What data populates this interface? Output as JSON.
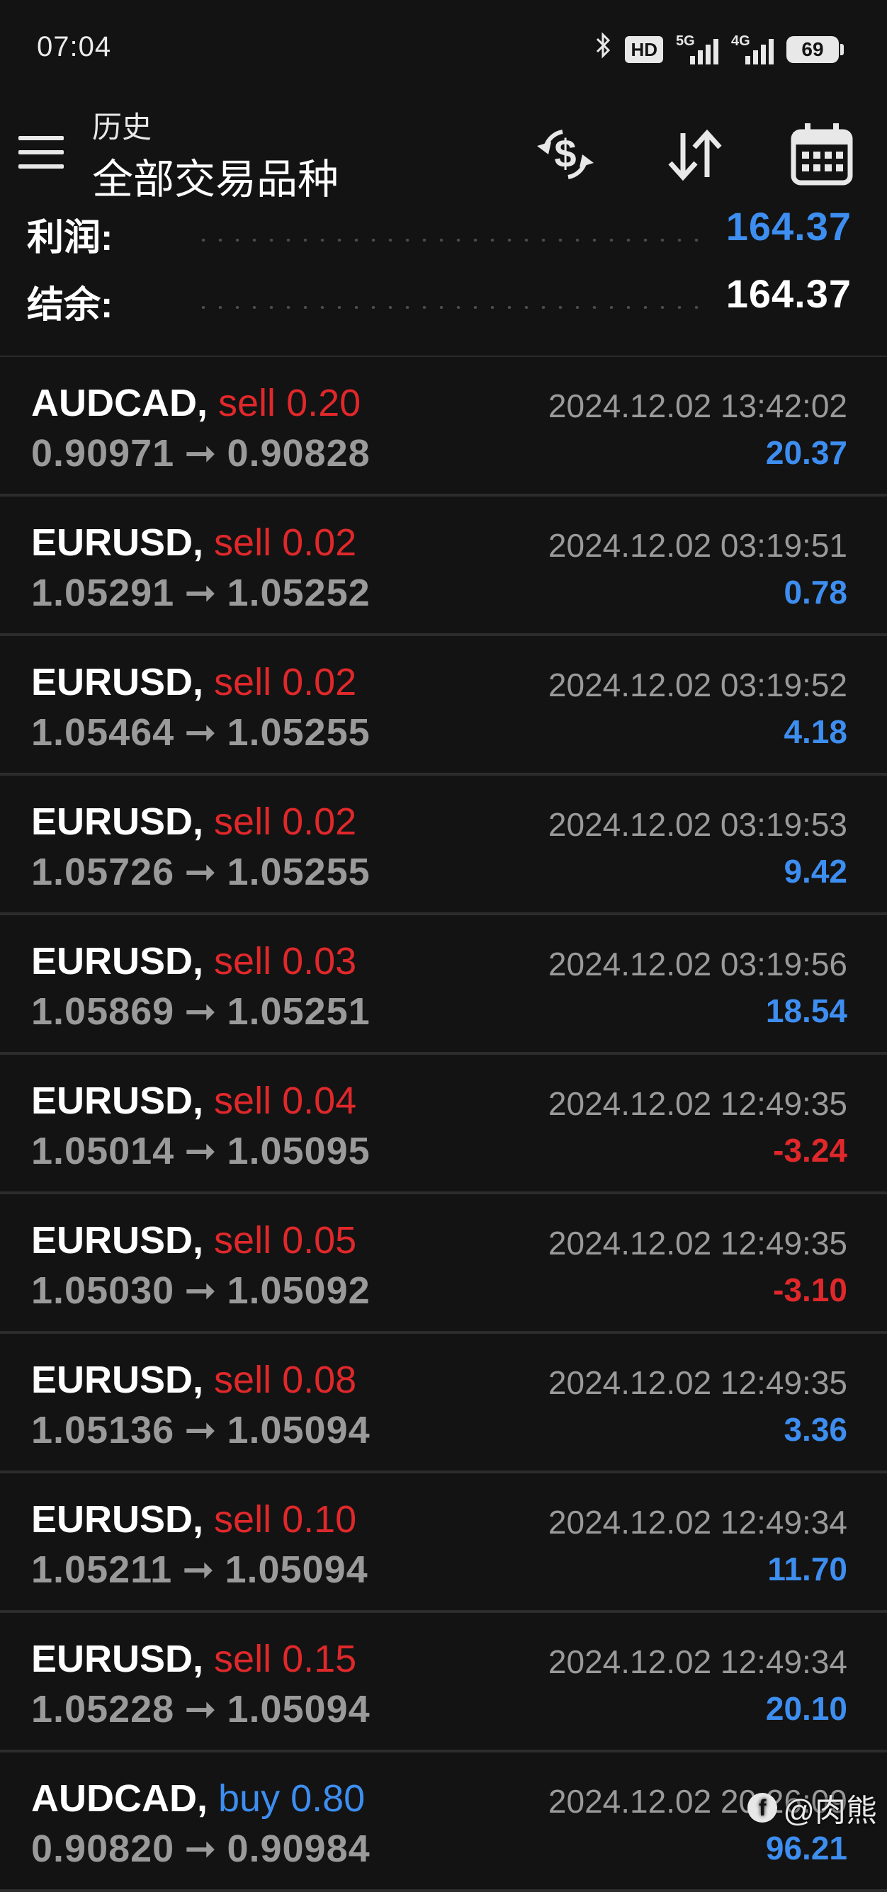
{
  "status_bar": {
    "time": "07:04",
    "hd_label": "HD",
    "network_5g": "5G",
    "network_4g": "4G",
    "battery": "69"
  },
  "toolbar": {
    "subtitle": "历史",
    "title": "全部交易品种",
    "icons": [
      "menu-icon",
      "dollar-refresh-icon",
      "sort-icon",
      "calendar-icon"
    ]
  },
  "summary": {
    "profit_label": "利润:",
    "profit_value": "164.37",
    "balance_label": "结余:",
    "balance_value": "164.37"
  },
  "trades": [
    {
      "symbol": "AUDCAD,",
      "side": "sell",
      "volume": "0.20",
      "open": "0.90971",
      "close": "0.90828",
      "time": "2024.12.02 13:42:02",
      "profit": "20.37",
      "profit_sign": "pos"
    },
    {
      "symbol": "EURUSD,",
      "side": "sell",
      "volume": "0.02",
      "open": "1.05291",
      "close": "1.05252",
      "time": "2024.12.02 03:19:51",
      "profit": "0.78",
      "profit_sign": "pos"
    },
    {
      "symbol": "EURUSD,",
      "side": "sell",
      "volume": "0.02",
      "open": "1.05464",
      "close": "1.05255",
      "time": "2024.12.02 03:19:52",
      "profit": "4.18",
      "profit_sign": "pos"
    },
    {
      "symbol": "EURUSD,",
      "side": "sell",
      "volume": "0.02",
      "open": "1.05726",
      "close": "1.05255",
      "time": "2024.12.02 03:19:53",
      "profit": "9.42",
      "profit_sign": "pos"
    },
    {
      "symbol": "EURUSD,",
      "side": "sell",
      "volume": "0.03",
      "open": "1.05869",
      "close": "1.05251",
      "time": "2024.12.02 03:19:56",
      "profit": "18.54",
      "profit_sign": "pos"
    },
    {
      "symbol": "EURUSD,",
      "side": "sell",
      "volume": "0.04",
      "open": "1.05014",
      "close": "1.05095",
      "time": "2024.12.02 12:49:35",
      "profit": "-3.24",
      "profit_sign": "neg"
    },
    {
      "symbol": "EURUSD,",
      "side": "sell",
      "volume": "0.05",
      "open": "1.05030",
      "close": "1.05092",
      "time": "2024.12.02 12:49:35",
      "profit": "-3.10",
      "profit_sign": "neg"
    },
    {
      "symbol": "EURUSD,",
      "side": "sell",
      "volume": "0.08",
      "open": "1.05136",
      "close": "1.05094",
      "time": "2024.12.02 12:49:35",
      "profit": "3.36",
      "profit_sign": "pos"
    },
    {
      "symbol": "EURUSD,",
      "side": "sell",
      "volume": "0.10",
      "open": "1.05211",
      "close": "1.05094",
      "time": "2024.12.02 12:49:34",
      "profit": "11.70",
      "profit_sign": "pos"
    },
    {
      "symbol": "EURUSD,",
      "side": "sell",
      "volume": "0.15",
      "open": "1.05228",
      "close": "1.05094",
      "time": "2024.12.02 12:49:34",
      "profit": "20.10",
      "profit_sign": "pos"
    },
    {
      "symbol": "AUDCAD,",
      "side": "buy",
      "volume": "0.80",
      "open": "0.90820",
      "close": "0.90984",
      "time": "2024.12.02 20:26:09",
      "profit": "96.21",
      "profit_sign": "pos"
    }
  ],
  "watermark": {
    "text": "@肉熊"
  },
  "colors": {
    "background": "#131313",
    "positive": "#3d8ef0",
    "negative": "#e0282b",
    "muted": "#9a9a9a",
    "divider": "#2c2c2c"
  }
}
